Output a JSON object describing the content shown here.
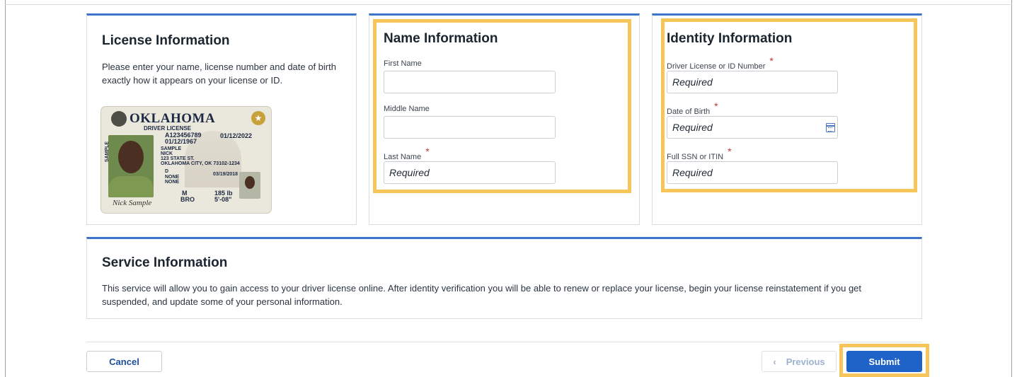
{
  "license_card": {
    "title": "License Information",
    "description": "Please enter your name, license number and date of birth exactly how it appears on your license or ID.",
    "sample_license": {
      "state": "OKLAHOMA",
      "type": "DRIVER LICENSE",
      "license_number": "A123456789",
      "expiration": "01/12/2022",
      "dob": "01/12/1967",
      "last_name": "SAMPLE",
      "first_name": "NICK",
      "address1": "123 STATE ST.",
      "address2": "OKLAHOMA CITY, OK 73102-1234",
      "class": "D",
      "issued": "03/19/2018",
      "endorsements": "NONE",
      "restrictions": "NONE",
      "sex": "M",
      "weight": "185 lb",
      "eyes": "BRO",
      "height": "5'-08\"",
      "vertical_label": "SAMPLE",
      "signature": "Nick Sample"
    }
  },
  "name_card": {
    "title": "Name Information",
    "first_name": {
      "label": "First Name",
      "value": "",
      "placeholder": ""
    },
    "middle_name": {
      "label": "Middle Name",
      "value": "",
      "placeholder": ""
    },
    "last_name": {
      "label": "Last Name",
      "required_mark": "*",
      "placeholder": "Required"
    }
  },
  "identity_card": {
    "title": "Identity Information",
    "license_number": {
      "label": "Driver License or ID Number",
      "required_mark": "*",
      "placeholder": "Required"
    },
    "dob": {
      "label": "Date of Birth",
      "required_mark": "*",
      "placeholder": "Required",
      "icon": "calendar-icon"
    },
    "ssn": {
      "label": "Full SSN or ITIN",
      "required_mark": "*",
      "placeholder": "Required"
    }
  },
  "service_card": {
    "title": "Service Information",
    "description": "This service will allow you to gain access to your driver license online. After identity verification you will be able to renew or replace your license, begin your license reinstatement if you get suspended, and update some of your personal information."
  },
  "footer": {
    "cancel_label": "Cancel",
    "previous_label": "Previous",
    "previous_icon": "‹",
    "submit_label": "Submit"
  },
  "colors": {
    "accent": "#3d73c9",
    "submit": "#1f63c9",
    "highlight": "#f6c65a",
    "required": "#c23934"
  }
}
